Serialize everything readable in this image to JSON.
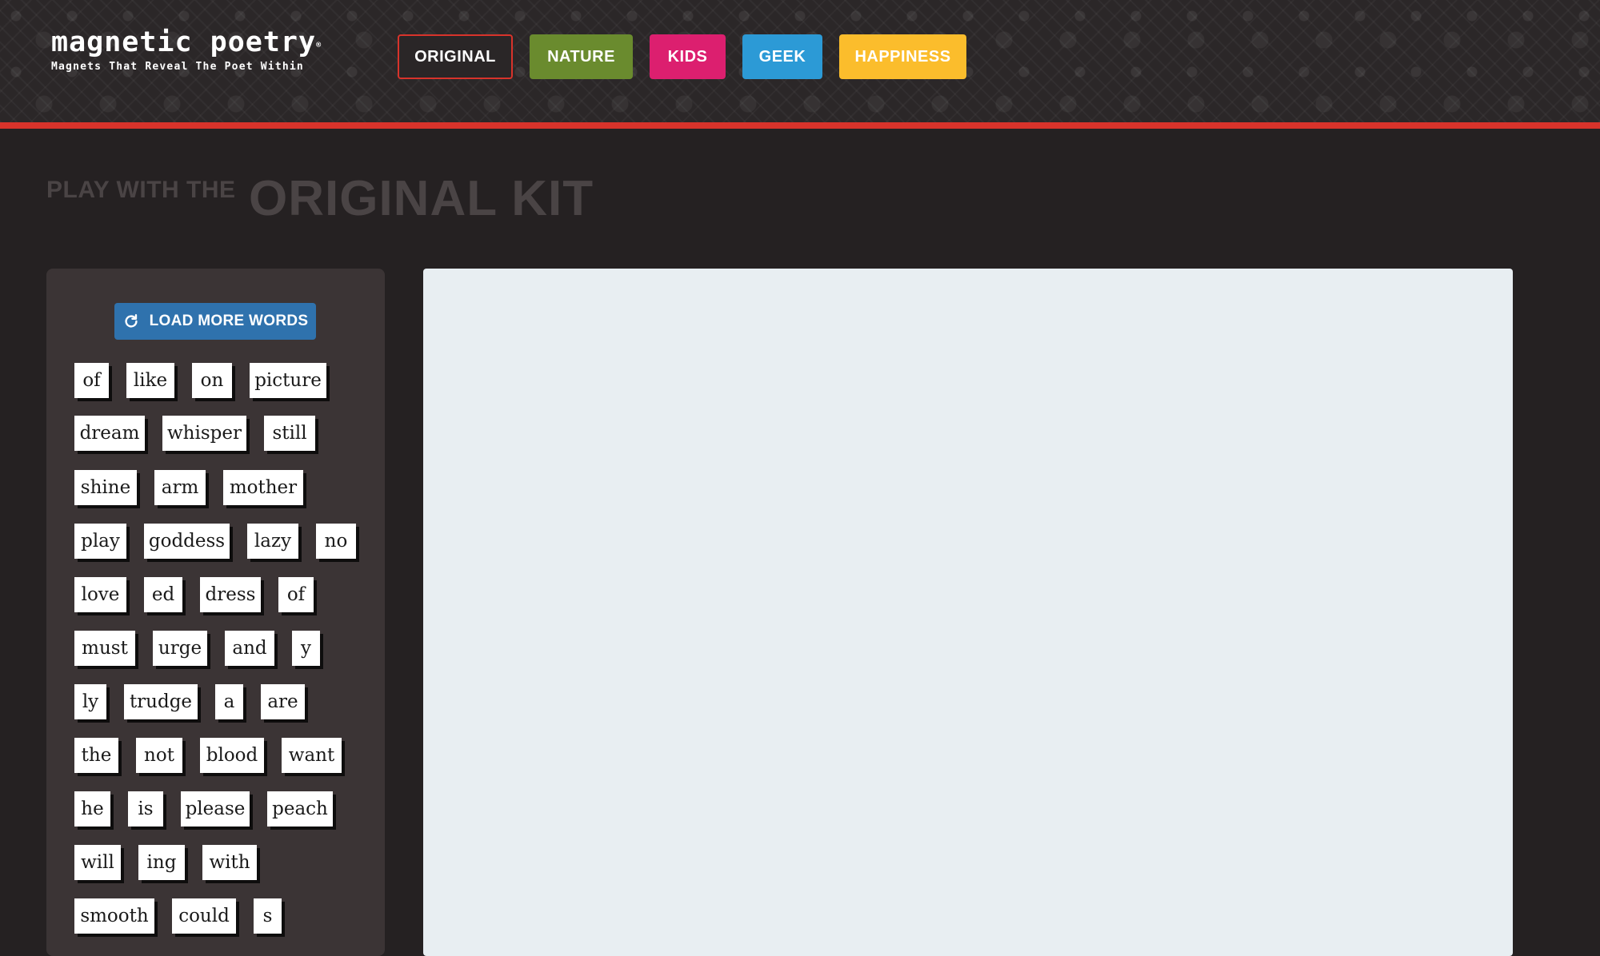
{
  "header": {
    "logo_title": "magnetic poetry",
    "logo_registered": "®",
    "logo_tagline": "Magnets That Reveal The Poet Within",
    "kits": [
      {
        "label": "ORIGINAL",
        "color": "#2a2627",
        "selected": true
      },
      {
        "label": "NATURE",
        "color": "#6a8b2e"
      },
      {
        "label": "KIDS",
        "color": "#dc1f6f"
      },
      {
        "label": "GEEK",
        "color": "#2c9ad6"
      },
      {
        "label": "HAPPINESS",
        "color": "#fbbd2c"
      }
    ],
    "accent_color": "#d8332b"
  },
  "page": {
    "title_prefix": "PLAY WITH THE",
    "title_main": "ORIGINAL KIT"
  },
  "word_panel": {
    "load_more_label": "LOAD MORE WORDS",
    "load_more_icon": "refresh-icon",
    "words": [
      "of",
      "like",
      "on",
      "picture",
      "dream",
      "whisper",
      "still",
      "shine",
      "arm",
      "mother",
      "play",
      "goddess",
      "lazy",
      "no",
      "love",
      "ed",
      "dress",
      "of",
      "must",
      "urge",
      "and",
      "y",
      "ly",
      "trudge",
      "a",
      "are",
      "the",
      "not",
      "blood",
      "want",
      "he",
      "is",
      "please",
      "peach",
      "will",
      "ing",
      "with",
      "smooth",
      "could",
      "s"
    ]
  },
  "board": {
    "background_color": "#e8eef2"
  }
}
